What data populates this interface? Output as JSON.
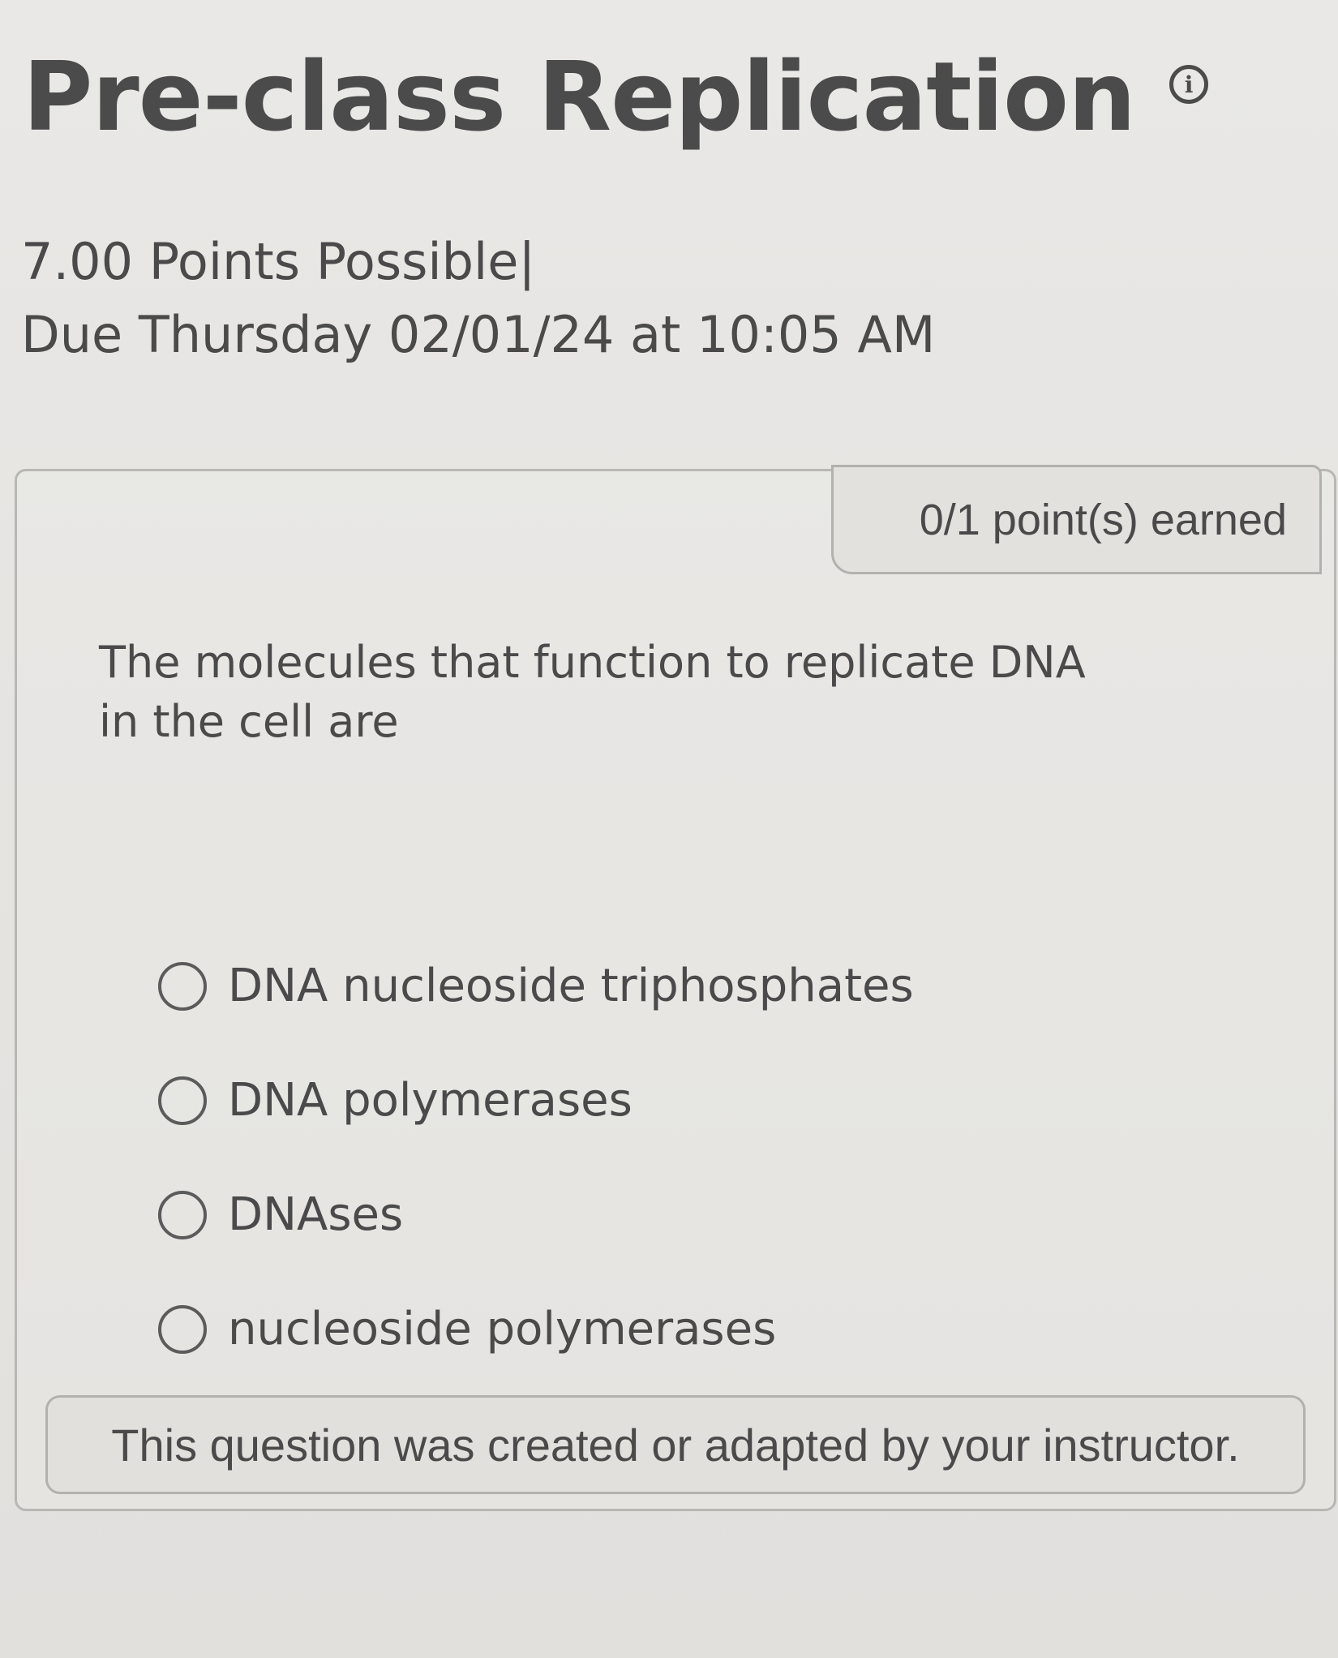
{
  "header": {
    "title": "Pre-class Replication",
    "info_icon": "info-circle-icon",
    "points": "7.00 Points Possible|",
    "due": "Due Thursday 02/01/24 at 10:05 AM"
  },
  "question": {
    "score": "0/1 point(s) earned",
    "prompt": "The molecules that function to replicate DNA in the cell are",
    "options": [
      {
        "label": "DNA nucleoside triphosphates",
        "selected": false
      },
      {
        "label": "DNA polymerases",
        "selected": false
      },
      {
        "label": "DNAses",
        "selected": false
      },
      {
        "label": "nucleoside polymerases",
        "selected": false
      }
    ],
    "footer_note": "This question was created or adapted by your instructor."
  }
}
